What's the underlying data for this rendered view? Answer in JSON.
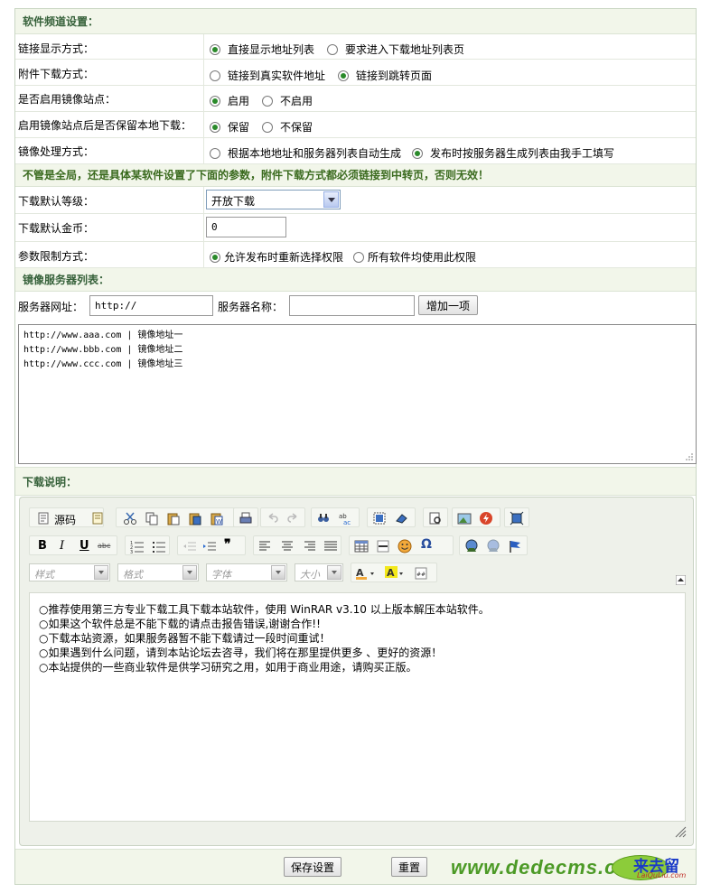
{
  "section_channel": "软件频道设置：",
  "link_display": {
    "label": "链接显示方式：",
    "options": [
      "直接显示地址列表",
      "要求进入下载地址列表页"
    ],
    "selected": 0
  },
  "attach_download": {
    "label": "附件下载方式：",
    "options": [
      "链接到真实软件地址",
      "链接到跳转页面"
    ],
    "selected": 1
  },
  "mirror_enable": {
    "label": "是否启用镜像站点：",
    "options": [
      "启用",
      "不启用"
    ],
    "selected": 0
  },
  "mirror_keep_local": {
    "label": "启用镜像站点后是否保留本地下载：",
    "options": [
      "保留",
      "不保留"
    ],
    "selected": 0
  },
  "mirror_process": {
    "label": "镜像处理方式：",
    "options": [
      "根据本地地址和服务器列表自动生成",
      "发布时按服务器生成列表由我手工填写"
    ],
    "selected": 1
  },
  "notice": "不管是全局，还是具体某软件设置了下面的参数，附件下载方式都必须链接到中转页，否则无效！",
  "download_level": {
    "label": "下载默认等级：",
    "value": "开放下载"
  },
  "download_gold": {
    "label": "下载默认金币：",
    "value": "0"
  },
  "param_limit": {
    "label": "参数限制方式：",
    "options": [
      "允许发布时重新选择权限",
      "所有软件均使用此权限"
    ],
    "selected": 0
  },
  "section_mirror_list": "镜像服务器列表：",
  "server": {
    "url_label": "服务器网址：",
    "url_value": "http://",
    "name_label": "服务器名称：",
    "name_value": "",
    "add_button": "增加一项"
  },
  "mirror_list": [
    "http://www.aaa.com | 镜像地址一",
    "http://www.bbb.com | 镜像地址二",
    "http://www.ccc.com | 镜像地址三"
  ],
  "section_download_desc": "下载说明：",
  "editor": {
    "source_label": "源码",
    "combos": [
      "样式",
      "格式",
      "字体",
      "大小"
    ],
    "content_lines": [
      "推荐使用第三方专业下载工具下载本站软件，使用 WinRAR v3.10 以上版本解压本站软件。",
      "如果这个软件总是不能下载的请点击报告错误,谢谢合作!!",
      "下载本站资源，如果服务器暂不能下载请过一段时间重试！",
      "如果遇到什么问题，请到本站论坛去咨寻，我们将在那里提供更多 、更好的资源！",
      "本站提供的一些商业软件是供学习研究之用，如用于商业用途，请购买正版。"
    ]
  },
  "buttons": {
    "save": "保存设置",
    "reset": "重置"
  },
  "watermark": {
    "site": "www.dedecms.com",
    "badge": "来去留",
    "badge_sub": "LaiQuLiu.com"
  },
  "colors": {
    "section_bg": "#f2f6ea",
    "section_text": "#36613a",
    "radio_on": "#2a8a2a"
  }
}
